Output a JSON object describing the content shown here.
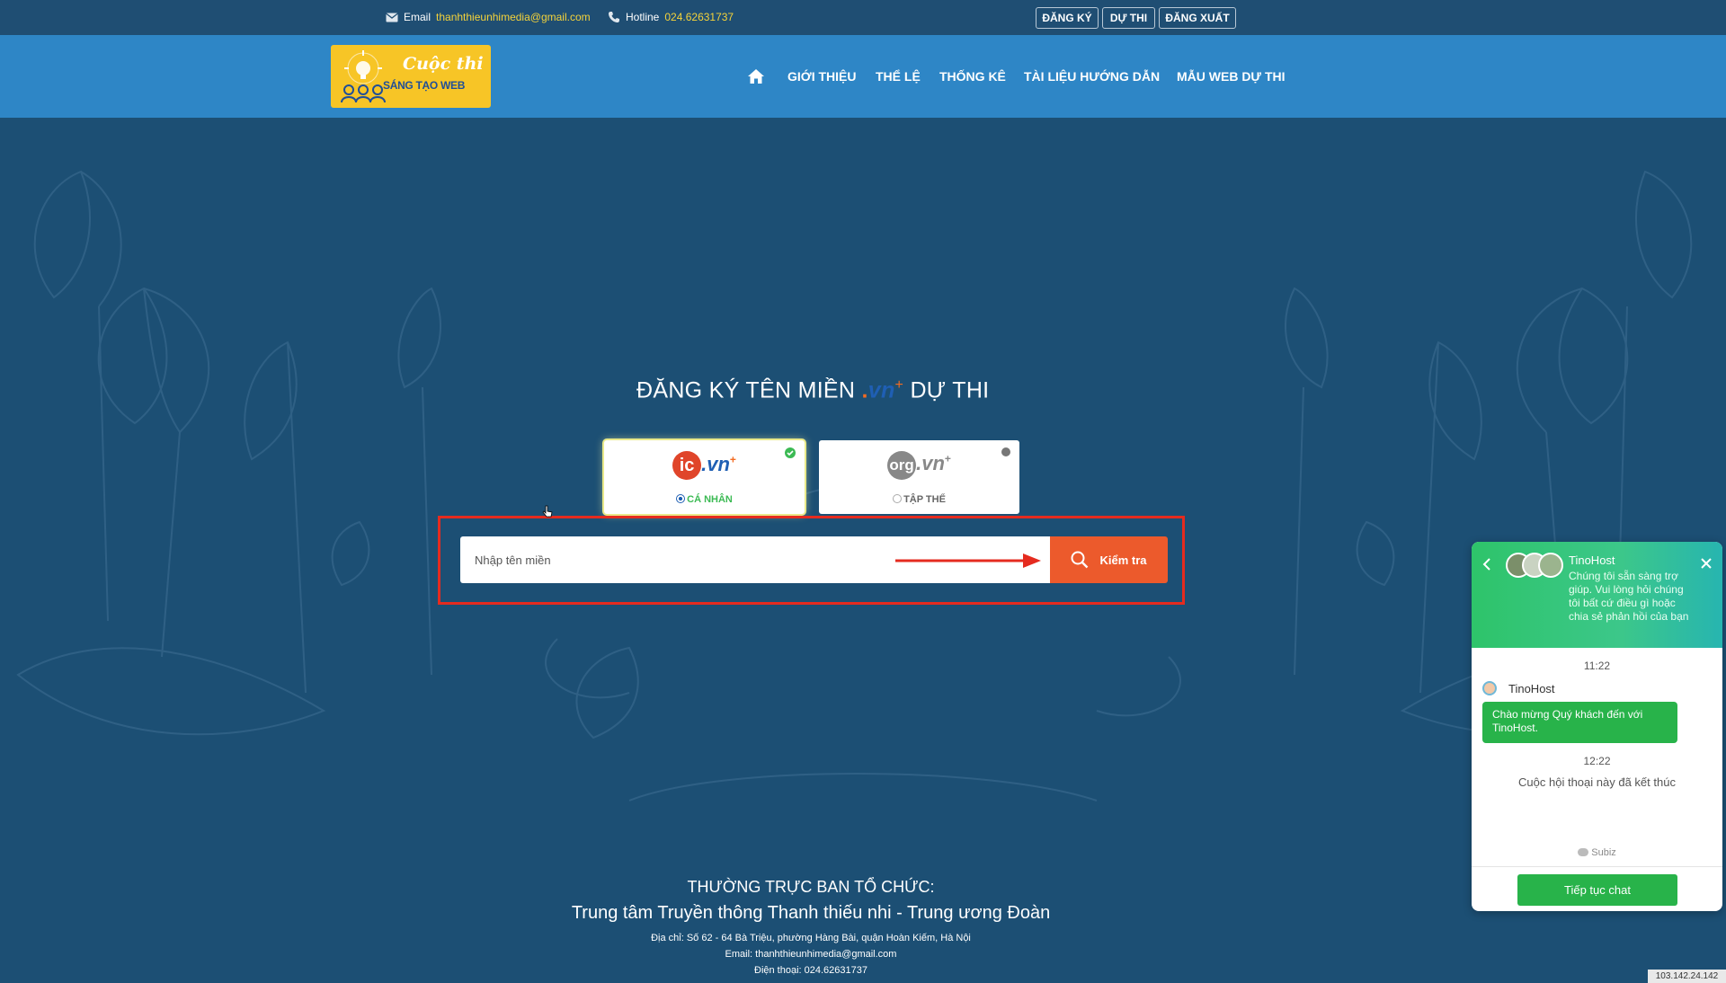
{
  "topbar": {
    "email_label": "Email",
    "email_value": "thanhthieunhimedia@gmail.com",
    "hotline_label": "Hotline",
    "hotline_value": "024.62631737",
    "register": "ĐĂNG KÝ",
    "compete": "DỰ THI",
    "logout": "ĐĂNG XUẤT"
  },
  "logo": {
    "line1": "Cuộc thi",
    "line2": "SÁNG TẠO WEB"
  },
  "nav": {
    "home_icon": "home-icon",
    "items": [
      "GIỚI THIỆU",
      "THỂ LỆ",
      "THỐNG KÊ",
      "TÀI LIỆU HƯỚNG DẪN",
      "MẪU WEB DỰ THI"
    ]
  },
  "hero": {
    "title_prefix": "ĐĂNG KÝ TÊN MIỀN",
    "title_dot": ".",
    "title_vn": "vn",
    "title_plus": "+",
    "title_suffix": "DỰ THI",
    "card_personal": {
      "brand_a": "ic",
      "brand_b": ".vn",
      "label": "CÁ NHÂN",
      "selected": true
    },
    "card_group": {
      "brand_a": "org",
      "brand_b": ".vn",
      "label": "TẬP THỂ",
      "selected": false
    },
    "search_placeholder": "Nhập tên miền",
    "search_button": "Kiểm tra"
  },
  "footer": {
    "heading": "THƯỜNG TRỰC BAN TỔ CHỨC:",
    "org": "Trung tâm Truyền thông Thanh thiếu nhi - Trung ương Đoàn",
    "address": "Địa chỉ: Số 62 - 64 Bà Triệu, phường Hàng Bài, quận Hoàn Kiếm, Hà Nội",
    "email": "Email: thanhthieunhimedia@gmail.com",
    "phone": "Điện thoại: 024.62631737"
  },
  "chat": {
    "name": "TinoHost",
    "subtitle": "Chúng tôi sẵn sàng trợ giúp. Vui lòng hỏi chúng tôi bất cứ điều gì hoặc chia sẻ phản hồi của bạn",
    "time1": "11:22",
    "agent_name": "TinoHost",
    "message": "Chào mừng Quý khách đến với TinoHost.",
    "time2": "12:22",
    "ended": "Cuộc hội thoại này đã kết thúc",
    "powered": "Subiz",
    "continue": "Tiếp tục chat"
  },
  "ip_badge": "103.142.24.142",
  "colors": {
    "topbar": "#1f4e73",
    "nav": "#2e86c6",
    "hero": "#1c4f74",
    "accent_orange": "#ec5a2c",
    "chat_green": "#28b34a"
  }
}
